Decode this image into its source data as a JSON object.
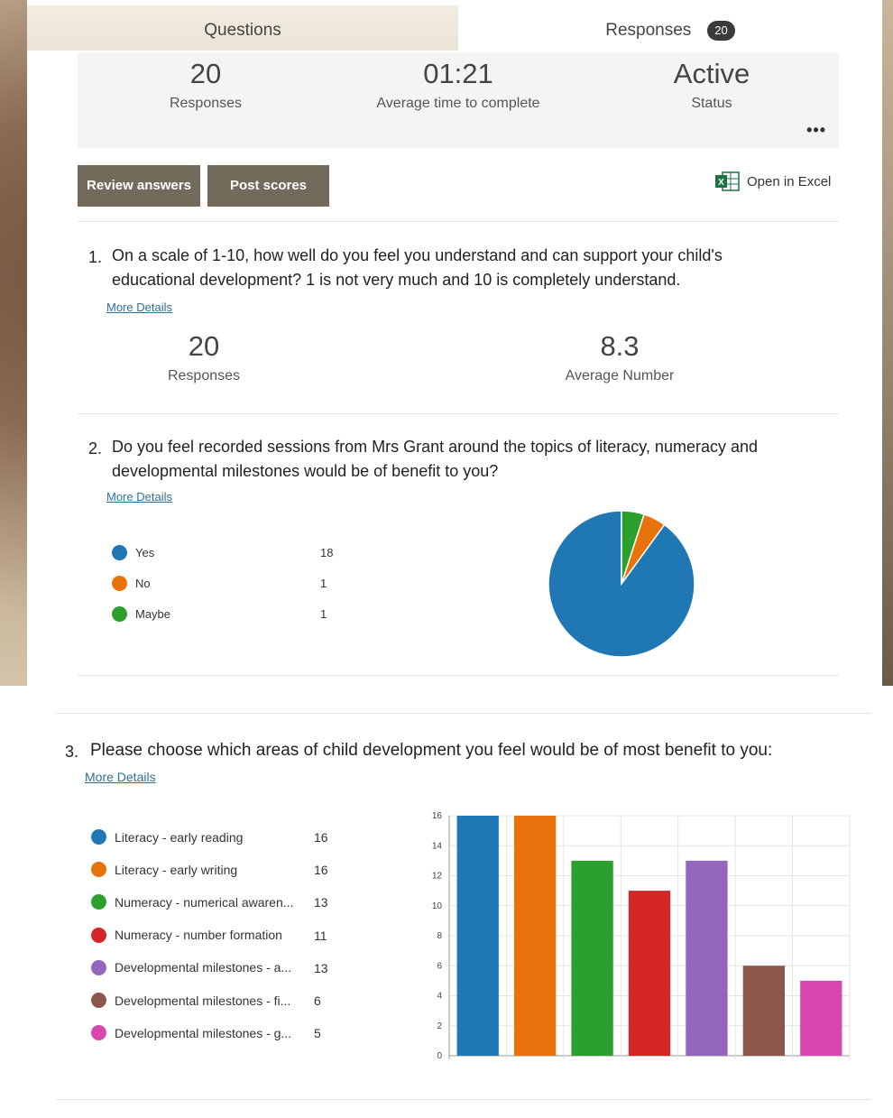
{
  "tabs": {
    "questions": "Questions",
    "responses": "Responses",
    "responses_badge": "20"
  },
  "summary": {
    "responses_value": "20",
    "responses_label": "Responses",
    "avg_time_value": "01:21",
    "avg_time_label": "Average time to complete",
    "status_value": "Active",
    "status_label": "Status",
    "more_icon": "•••"
  },
  "actions": {
    "review": "Review answers",
    "post": "Post scores",
    "excel": "Open in Excel"
  },
  "q1": {
    "number": "1.",
    "text_line1": "On a scale of 1-10, how well do you feel you understand and can support your child's",
    "text_line2": "educational development? 1 is not very much and 10 is completely understand.",
    "more": "More Details",
    "responses_value": "20",
    "responses_label": "Responses",
    "avg_value": "8.3",
    "avg_label": "Average Number"
  },
  "q2": {
    "number": "2.",
    "text_line1": "Do you feel recorded sessions from Mrs Grant around the topics of literacy, numeracy and",
    "text_line2": "developmental milestones would be of benefit to you?",
    "more": "More Details",
    "legend": [
      {
        "label": "Yes",
        "count": "18",
        "color": "#1f77b4"
      },
      {
        "label": "No",
        "count": "1",
        "color": "#e8730c"
      },
      {
        "label": "Maybe",
        "count": "1",
        "color": "#2ca02c"
      }
    ]
  },
  "q3": {
    "number": "3.",
    "text": "Please choose which areas of child development you feel would be of most benefit to you:",
    "more": "More Details",
    "legend": [
      {
        "label": "Literacy - early reading",
        "count": "16",
        "color": "#1f77b4"
      },
      {
        "label": "Literacy - early writing",
        "count": "16",
        "color": "#e8730c"
      },
      {
        "label": "Numeracy - numerical awaren...",
        "count": "13",
        "color": "#2ca02c"
      },
      {
        "label": "Numeracy - number formation",
        "count": "11",
        "color": "#d62728"
      },
      {
        "label": "Developmental milestones - a...",
        "count": "13",
        "color": "#9467bd"
      },
      {
        "label": "Developmental milestones - fi...",
        "count": "6",
        "color": "#8c564b"
      },
      {
        "label": "Developmental milestones - g...",
        "count": "5",
        "color": "#d946b0"
      }
    ]
  },
  "chart_data": [
    {
      "type": "pie",
      "categories": [
        "Yes",
        "No",
        "Maybe"
      ],
      "values": [
        18,
        1,
        1
      ],
      "colors": [
        "#1f77b4",
        "#e8730c",
        "#2ca02c"
      ]
    },
    {
      "type": "bar",
      "categories": [
        "Literacy - early reading",
        "Literacy - early writing",
        "Numeracy - numerical awaren...",
        "Numeracy - number formation",
        "Developmental milestones - a...",
        "Developmental milestones - fi...",
        "Developmental milestones - g..."
      ],
      "values": [
        16,
        16,
        13,
        11,
        13,
        6,
        5
      ],
      "colors": [
        "#1f77b4",
        "#e8730c",
        "#2ca02c",
        "#d62728",
        "#9467bd",
        "#8c564b",
        "#d946b0"
      ],
      "ylim": [
        0,
        16
      ],
      "yticks": [
        0,
        2,
        4,
        6,
        8,
        10,
        12,
        14,
        16
      ],
      "grid": true
    }
  ]
}
